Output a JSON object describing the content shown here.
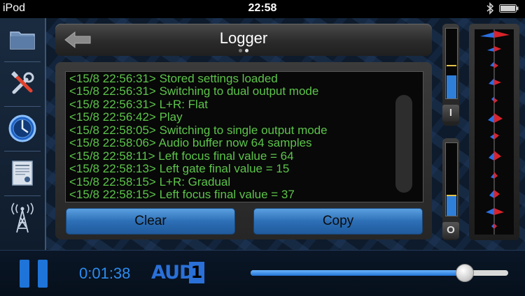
{
  "status": {
    "carrier": "iPod",
    "time": "22:58"
  },
  "sidebar": {
    "items": [
      {
        "name": "folder"
      },
      {
        "name": "tools"
      },
      {
        "name": "clock"
      },
      {
        "name": "certificate"
      },
      {
        "name": "antenna"
      }
    ],
    "active_index": 2
  },
  "header": {
    "title": "Logger",
    "page_count": 2,
    "active_page": 1
  },
  "log": {
    "lines": [
      "<15/8 22:56:31> Stored settings loaded",
      "<15/8 22:56:31> Switching to dual output mode",
      "<15/8 22:56:31> L+R: Flat",
      "<15/8 22:56:42> Play",
      "<15/8 22:58:05> Switching to single output mode",
      "<15/8 22:58:06> Audio buffer now 64 samples",
      "<15/8 22:58:11> Left focus final value = 64",
      "<15/8 22:58:13> Left gate final value = 15",
      "<15/8 22:58:15> L+R: Gradual",
      "<15/8 22:58:15> Left focus final value = 37"
    ],
    "color": "#5cc44a"
  },
  "buttons": {
    "clear": "Clear",
    "copy": "Copy"
  },
  "meters": {
    "input": {
      "label": "I",
      "level": 0.33,
      "peak": 0.46
    },
    "output": {
      "label": "O",
      "level": 0.27,
      "peak": 0.27
    }
  },
  "player": {
    "elapsed": "0:01:38",
    "mode_label": "AUD",
    "mode_index": "1",
    "progress": 0.83
  },
  "colors": {
    "accent": "#2c8cf0",
    "log_text": "#5cc44a",
    "wave_red": "#d8232a",
    "wave_blue": "#2a6fe0"
  }
}
